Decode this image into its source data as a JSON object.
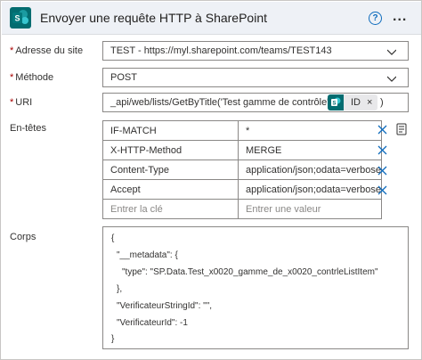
{
  "header": {
    "title": "Envoyer une requête HTTP à SharePoint",
    "help_glyph": "?",
    "more_glyph": "...",
    "accent": "#036c70"
  },
  "form": {
    "site": {
      "label": "Adresse du site",
      "required": true,
      "value": "TEST - https://myl.sharepoint.com/teams/TEST143"
    },
    "method": {
      "label": "Méthode",
      "required": true,
      "value": "POST"
    },
    "uri": {
      "label": "URI",
      "required": true,
      "value": "_api/web/lists/GetByTitle('Test gamme de contrôle')/items(",
      "token_label": "ID",
      "token_close": "×",
      "suffix": ")"
    },
    "headers": {
      "label": "En-têtes",
      "rows": [
        {
          "key": "IF-MATCH",
          "value": "*"
        },
        {
          "key": "X-HTTP-Method",
          "value": "MERGE"
        },
        {
          "key": "Content-Type",
          "value": "application/json;odata=verbose"
        },
        {
          "key": "Accept",
          "value": "application/json;odata=verbose"
        }
      ],
      "key_placeholder": "Entrer la clé",
      "value_placeholder": "Entrer une valeur"
    },
    "body": {
      "label": "Corps",
      "lines": [
        "{",
        "\"__metadata\": {",
        "\"type\": \"SP.Data.Test_x0020_gamme_de_x0020_contrleListItem\"",
        "},",
        "\"VerificateurStringId\": \"\",",
        "\"VerificateurId\": -1",
        "}"
      ]
    }
  }
}
